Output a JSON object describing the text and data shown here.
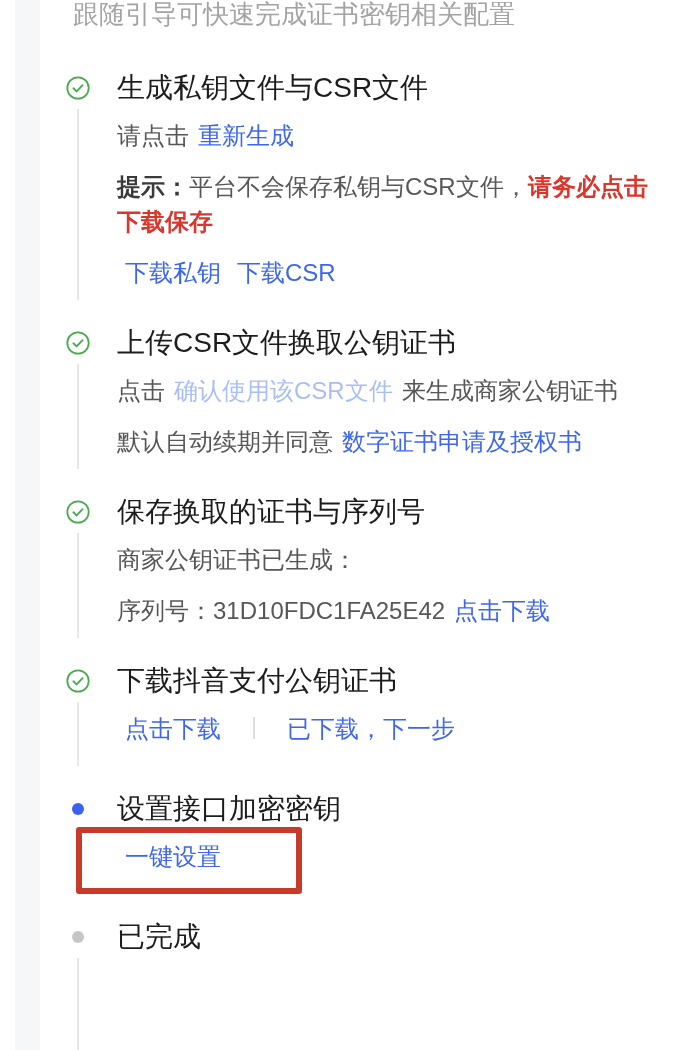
{
  "subtitle": "跟随引导可快速完成证书密钥相关配置",
  "steps": [
    {
      "completed": true,
      "active": false,
      "title": "生成私钥文件与CSR文件",
      "lines": [
        {
          "kind": "sentence",
          "parts": [
            {
              "kind": "text",
              "text": "请点击"
            },
            {
              "kind": "link",
              "text": "重新生成",
              "disabled": false
            }
          ]
        },
        {
          "kind": "sentence",
          "parts": [
            {
              "kind": "label",
              "text": "提示："
            },
            {
              "kind": "text",
              "text": "平台不会保存私钥与CSR文件，"
            },
            {
              "kind": "warning",
              "text": "请务必点击下载保存"
            }
          ]
        },
        {
          "kind": "actions",
          "separated": false,
          "highlighted": false,
          "links": [
            {
              "text": "下载私钥",
              "disabled": false
            },
            {
              "text": "下载CSR",
              "disabled": false
            }
          ]
        }
      ]
    },
    {
      "completed": true,
      "active": false,
      "title": "上传CSR文件换取公钥证书",
      "lines": [
        {
          "kind": "sentence",
          "parts": [
            {
              "kind": "text",
              "text": "点击"
            },
            {
              "kind": "link",
              "text": "确认使用该CSR文件",
              "disabled": true
            },
            {
              "kind": "text",
              "text": "来生成商家公钥证书"
            }
          ]
        },
        {
          "kind": "sentence",
          "parts": [
            {
              "kind": "text",
              "text": "默认自动续期并同意"
            },
            {
              "kind": "link",
              "text": "数字证书申请及授权书",
              "disabled": false
            }
          ]
        }
      ]
    },
    {
      "completed": true,
      "active": false,
      "title": "保存换取的证书与序列号",
      "lines": [
        {
          "kind": "sentence",
          "parts": [
            {
              "kind": "text",
              "text": "商家公钥证书已生成："
            }
          ]
        },
        {
          "kind": "sentence",
          "parts": [
            {
              "kind": "text",
              "text": "序列号：31D10FDC1FA25E42"
            },
            {
              "kind": "link",
              "text": "点击下载",
              "disabled": false
            }
          ]
        }
      ]
    },
    {
      "completed": true,
      "active": false,
      "title": "下载抖音支付公钥证书",
      "lines": [
        {
          "kind": "actions",
          "separated": true,
          "highlighted": false,
          "links": [
            {
              "text": "点击下载",
              "disabled": false
            },
            {
              "text": "已下载，下一步",
              "disabled": false
            }
          ]
        }
      ]
    },
    {
      "completed": false,
      "active": true,
      "title": "设置接口加密密钥",
      "lines": [
        {
          "kind": "actions",
          "highlighted": true,
          "links": [
            {
              "text": "一键设置",
              "disabled": false
            }
          ]
        }
      ]
    },
    {
      "completed": false,
      "active": false,
      "title": "已完成"
    }
  ]
}
